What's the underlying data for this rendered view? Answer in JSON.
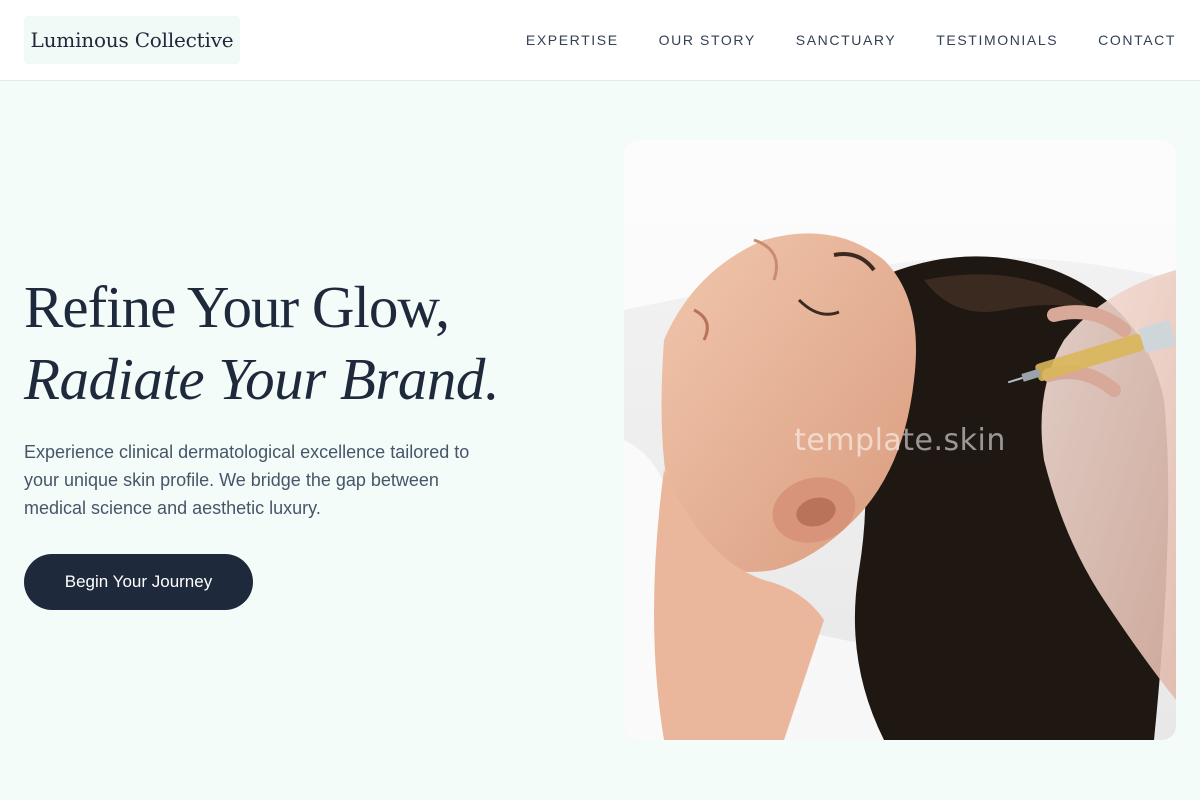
{
  "brand": {
    "logo_text": "Luminous Collective"
  },
  "nav": {
    "items": [
      {
        "label": "EXPERTISE"
      },
      {
        "label": "OUR STORY"
      },
      {
        "label": "SANCTUARY"
      },
      {
        "label": "TESTIMONIALS"
      },
      {
        "label": "CONTACT"
      }
    ]
  },
  "hero": {
    "headline_line1": "Refine Your Glow,",
    "headline_line2": "Radiate Your Brand.",
    "description": "Experience clinical dermatological excellence tailored to your unique skin profile. We bridge the gap between medical science and aesthetic luxury.",
    "cta_label": "Begin Your Journey",
    "image_watermark": "template.skin"
  },
  "colors": {
    "page_background": "#f3fcf8",
    "header_background": "#ffffff",
    "primary_dark": "#1e293b",
    "body_text": "#475569"
  }
}
